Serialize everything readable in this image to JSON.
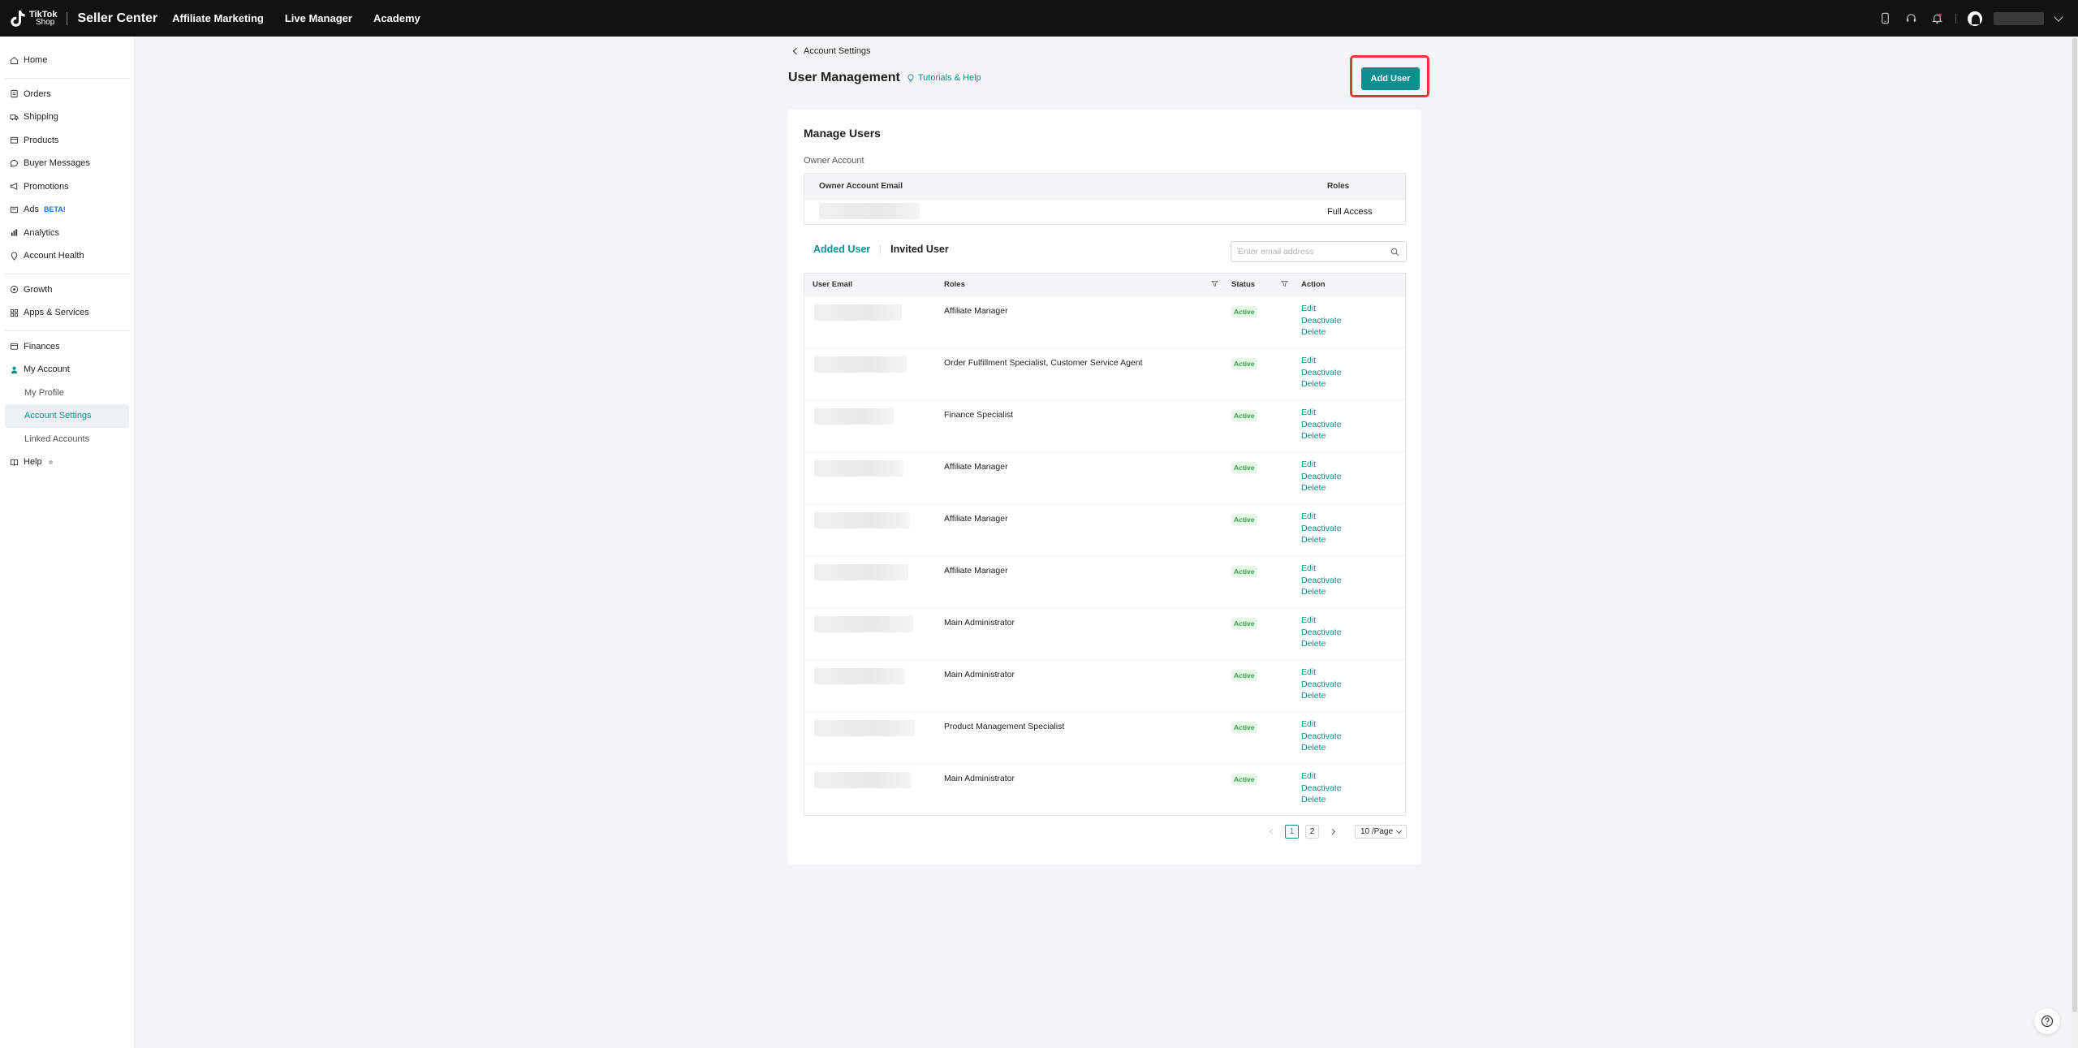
{
  "topbar": {
    "logo_line1": "TikTok",
    "logo_line2": "Shop",
    "app_title": "Seller Center",
    "nav": [
      "Affiliate Marketing",
      "Live Manager",
      "Academy"
    ]
  },
  "sidebar": {
    "home": "Home",
    "orders": "Orders",
    "shipping": "Shipping",
    "products": "Products",
    "buyer_messages": "Buyer Messages",
    "promotions": "Promotions",
    "ads": "Ads",
    "ads_badge": "BETA!",
    "analytics": "Analytics",
    "account_health": "Account Health",
    "growth": "Growth",
    "apps_services": "Apps & Services",
    "finances": "Finances",
    "my_account": "My Account",
    "my_profile": "My Profile",
    "account_settings": "Account Settings",
    "linked_accounts": "Linked Accounts",
    "help": "Help"
  },
  "header": {
    "breadcrumb": "Account Settings",
    "title": "User Management",
    "tutorials": "Tutorials & Help",
    "add_user": "Add User"
  },
  "manage": {
    "title": "Manage Users",
    "owner_label": "Owner Account",
    "owner_columns": [
      "Owner Account Email",
      "Roles"
    ],
    "owner_role": "Full Access",
    "tabs": [
      "Added User",
      "Invited User"
    ],
    "search_placeholder": "Enter email address",
    "columns": [
      "User Email",
      "Roles",
      "Status",
      "Action"
    ],
    "rows": [
      {
        "role": "Affiliate Manager",
        "status": "Active"
      },
      {
        "role": "Order Fulfillment Specialist, Customer Service Agent",
        "status": "Active"
      },
      {
        "role": "Finance Specialist",
        "status": "Active"
      },
      {
        "role": "Affiliate Manager",
        "status": "Active"
      },
      {
        "role": "Affiliate Manager",
        "status": "Active"
      },
      {
        "role": "Affiliate Manager",
        "status": "Active"
      },
      {
        "role": "Main Administrator",
        "status": "Active"
      },
      {
        "role": "Main Administrator",
        "status": "Active"
      },
      {
        "role": "Product Management Specialist",
        "status": "Active"
      },
      {
        "role": "Main Administrator",
        "status": "Active"
      }
    ],
    "actions": [
      "Edit",
      "Deactivate",
      "Delete"
    ]
  },
  "pagination": {
    "pages": [
      "1",
      "2"
    ],
    "current": "1",
    "page_size": "10 /Page"
  },
  "colors": {
    "accent": "#0e8f8f",
    "highlight_border": "#e53935",
    "status_green": "#2ea84b",
    "topbar": "#121212"
  }
}
